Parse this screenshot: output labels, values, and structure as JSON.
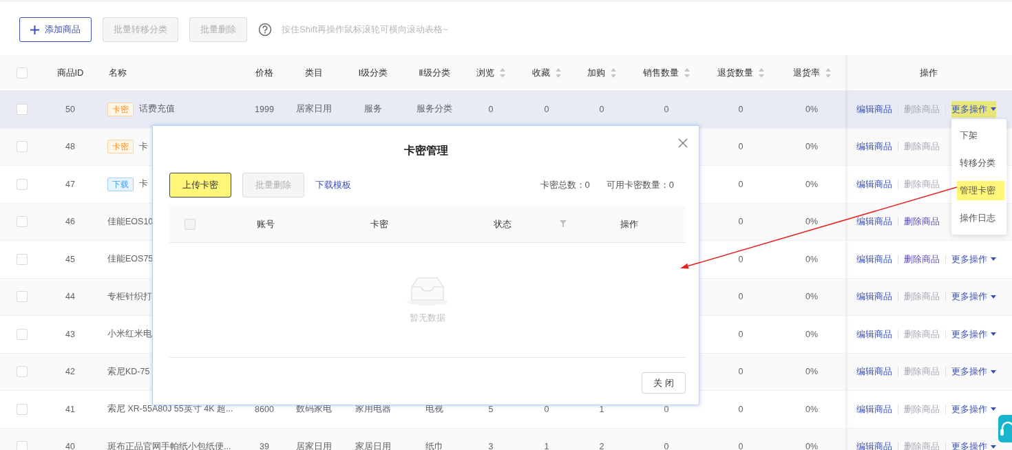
{
  "toolbar": {
    "buttons": [
      {
        "label": "添加商品",
        "kind": "primary",
        "disabled": false
      },
      {
        "label": "批量转移分类",
        "kind": "default",
        "disabled": true
      },
      {
        "label": "批量删除",
        "kind": "default",
        "disabled": true
      }
    ],
    "hint": "按住Shift再操作鼠标滚轮可横向滚动表格~"
  },
  "table": {
    "all_checked": false,
    "columns": [
      {
        "label": "商品ID",
        "sortable": false
      },
      {
        "label": "名称",
        "sortable": false
      },
      {
        "label": "价格",
        "sortable": false
      },
      {
        "label": "类目",
        "sortable": false
      },
      {
        "label": "Ⅰ级分类",
        "sortable": false
      },
      {
        "label": "Ⅱ级分类",
        "sortable": false
      },
      {
        "label": "浏览",
        "sortable": true
      },
      {
        "label": "收藏",
        "sortable": true
      },
      {
        "label": "加购",
        "sortable": true
      },
      {
        "label": "销售数量",
        "sortable": true
      },
      {
        "label": "退货数量",
        "sortable": true
      },
      {
        "label": "退货率",
        "sortable": true
      },
      {
        "label": "操作",
        "sortable": false
      }
    ],
    "rows": [
      {
        "checked": false,
        "hovered": true,
        "id": "50",
        "tag": {
          "label": "卡密",
          "kind": "card"
        },
        "name": "话费充值",
        "price": "1999",
        "category": "居家日用",
        "level1": "服务",
        "level2": "服务分类",
        "views": "0",
        "favorites": "0",
        "cart": "0",
        "sales": "0",
        "returns": "0",
        "return_rate": "0%",
        "actions": [
          {
            "label": "编辑商品",
            "kind": "edit",
            "disabled": false
          },
          {
            "label": "删除商品",
            "kind": "delete",
            "disabled": true
          },
          {
            "label": "更多操作",
            "kind": "more",
            "disabled": false,
            "highlighted": true
          }
        ]
      },
      {
        "checked": false,
        "hovered": false,
        "id": "48",
        "tag": {
          "label": "卡密",
          "kind": "card"
        },
        "name": "卡",
        "returns": "0",
        "return_rate": "0%",
        "actions": [
          {
            "label": "编辑商品",
            "kind": "edit",
            "disabled": false
          },
          {
            "label": "删除商品",
            "kind": "delete",
            "disabled": true
          }
        ]
      },
      {
        "checked": false,
        "hovered": false,
        "id": "47",
        "tag": {
          "label": "下载",
          "kind": "download"
        },
        "name": "卡",
        "returns": "0",
        "return_rate": "0%",
        "actions": [
          {
            "label": "编辑商品",
            "kind": "edit",
            "disabled": false
          },
          {
            "label": "删除商品",
            "kind": "delete",
            "disabled": true
          }
        ]
      },
      {
        "checked": false,
        "hovered": false,
        "id": "46",
        "name": "佳能EOS10",
        "returns": "0",
        "return_rate": "0%",
        "actions": [
          {
            "label": "编辑商品",
            "kind": "edit",
            "disabled": false
          },
          {
            "label": "删除商品",
            "kind": "delete",
            "disabled": false
          }
        ]
      },
      {
        "checked": false,
        "hovered": false,
        "id": "45",
        "name": "佳能EOS75",
        "returns": "0",
        "return_rate": "0%",
        "actions": [
          {
            "label": "编辑商品",
            "kind": "edit",
            "disabled": false
          },
          {
            "label": "删除商品",
            "kind": "delete",
            "disabled": false
          },
          {
            "label": "更多操作",
            "kind": "more",
            "disabled": false,
            "highlighted": false
          }
        ]
      },
      {
        "checked": false,
        "hovered": false,
        "id": "44",
        "name": "专柜针织打",
        "returns": "0",
        "return_rate": "0%",
        "actions": [
          {
            "label": "编辑商品",
            "kind": "edit",
            "disabled": false
          },
          {
            "label": "删除商品",
            "kind": "delete",
            "disabled": true
          },
          {
            "label": "更多操作",
            "kind": "more",
            "disabled": false,
            "highlighted": false
          }
        ]
      },
      {
        "checked": false,
        "hovered": false,
        "id": "43",
        "name": "小米红米电",
        "returns": "0",
        "return_rate": "0%",
        "actions": [
          {
            "label": "编辑商品",
            "kind": "edit",
            "disabled": false
          },
          {
            "label": "删除商品",
            "kind": "delete",
            "disabled": true
          },
          {
            "label": "更多操作",
            "kind": "more",
            "disabled": false,
            "highlighted": false
          }
        ]
      },
      {
        "checked": false,
        "hovered": false,
        "id": "42",
        "name": "索尼KD-75",
        "returns": "0",
        "return_rate": "0%",
        "actions": [
          {
            "label": "编辑商品",
            "kind": "edit",
            "disabled": false
          },
          {
            "label": "删除商品",
            "kind": "delete",
            "disabled": true
          },
          {
            "label": "更多操作",
            "kind": "more",
            "disabled": false,
            "highlighted": false
          }
        ]
      },
      {
        "checked": false,
        "hovered": false,
        "id": "41",
        "name": "索尼 XR-55A80J 55英寸 4K 超...",
        "price": "8600",
        "category": "数码家电",
        "level1": "家用电器",
        "level2": "电视",
        "views": "5",
        "favorites": "0",
        "cart": "1",
        "sales": "0",
        "returns": "0",
        "return_rate": "0%",
        "actions": [
          {
            "label": "编辑商品",
            "kind": "edit",
            "disabled": false
          },
          {
            "label": "删除商品",
            "kind": "delete",
            "disabled": true
          },
          {
            "label": "更多操作",
            "kind": "more",
            "disabled": false,
            "highlighted": false
          }
        ]
      },
      {
        "checked": false,
        "hovered": false,
        "id": "40",
        "name": "斑布正品官网手帕纸小包纸便...",
        "price": "39",
        "category": "居家日用",
        "level1": "家居日用",
        "level2": "纸巾",
        "views": "3",
        "favorites": "1",
        "cart": "2",
        "sales": "0",
        "returns": "0",
        "return_rate": "0%",
        "actions": [
          {
            "label": "编辑商品",
            "kind": "edit",
            "disabled": false
          },
          {
            "label": "删除商品",
            "kind": "delete",
            "disabled": true
          },
          {
            "label": "更多操作",
            "kind": "more",
            "disabled": false,
            "highlighted": false
          }
        ]
      }
    ]
  },
  "row_menu": {
    "items": [
      {
        "label": "下架",
        "highlighted": false
      },
      {
        "label": "转移分类",
        "highlighted": false
      },
      {
        "label": "管理卡密",
        "highlighted": true
      },
      {
        "label": "操作日志",
        "highlighted": false
      }
    ]
  },
  "dialog": {
    "title": "卡密管理",
    "buttons": [
      {
        "label": "上传卡密",
        "disabled": false,
        "highlighted": true
      },
      {
        "label": "批量删除",
        "disabled": true,
        "highlighted": false
      }
    ],
    "all_checked": false,
    "link": "下载模板",
    "stats": [
      "卡密总数：0",
      "可用卡密数量：0"
    ],
    "columns": [
      {
        "label": "账号",
        "filterable": false
      },
      {
        "label": "卡密",
        "filterable": false
      },
      {
        "label": "状态",
        "filterable": true
      },
      {
        "label": "操作",
        "filterable": false
      }
    ],
    "empty_text": "暂无数据",
    "footer_button": "关 闭"
  }
}
